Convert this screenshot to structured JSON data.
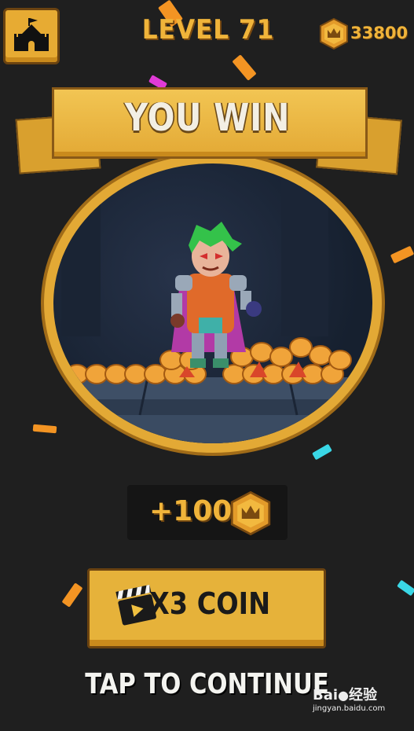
{
  "header": {
    "level_title": "LEVEL 71",
    "coin_total": "33800",
    "home_icon": "castle-icon",
    "coin_icon": "crown-coin-icon"
  },
  "banner": {
    "title": "YOU WIN"
  },
  "reward": {
    "amount": "+100",
    "icon": "crown-coin-icon"
  },
  "multiplier_button": {
    "label": "X3 COIN",
    "icon": "video-clapper-icon"
  },
  "continue_prompt": "TAP TO CONTINUE",
  "watermark": {
    "brand": "Bai",
    "brand_cn": "经验",
    "url": "jingyan.baidu.com"
  },
  "colors": {
    "background": "#1f1f1f",
    "gold": "#f0b43a",
    "banner": "#e3a935",
    "text_light": "#f4f4f0"
  }
}
